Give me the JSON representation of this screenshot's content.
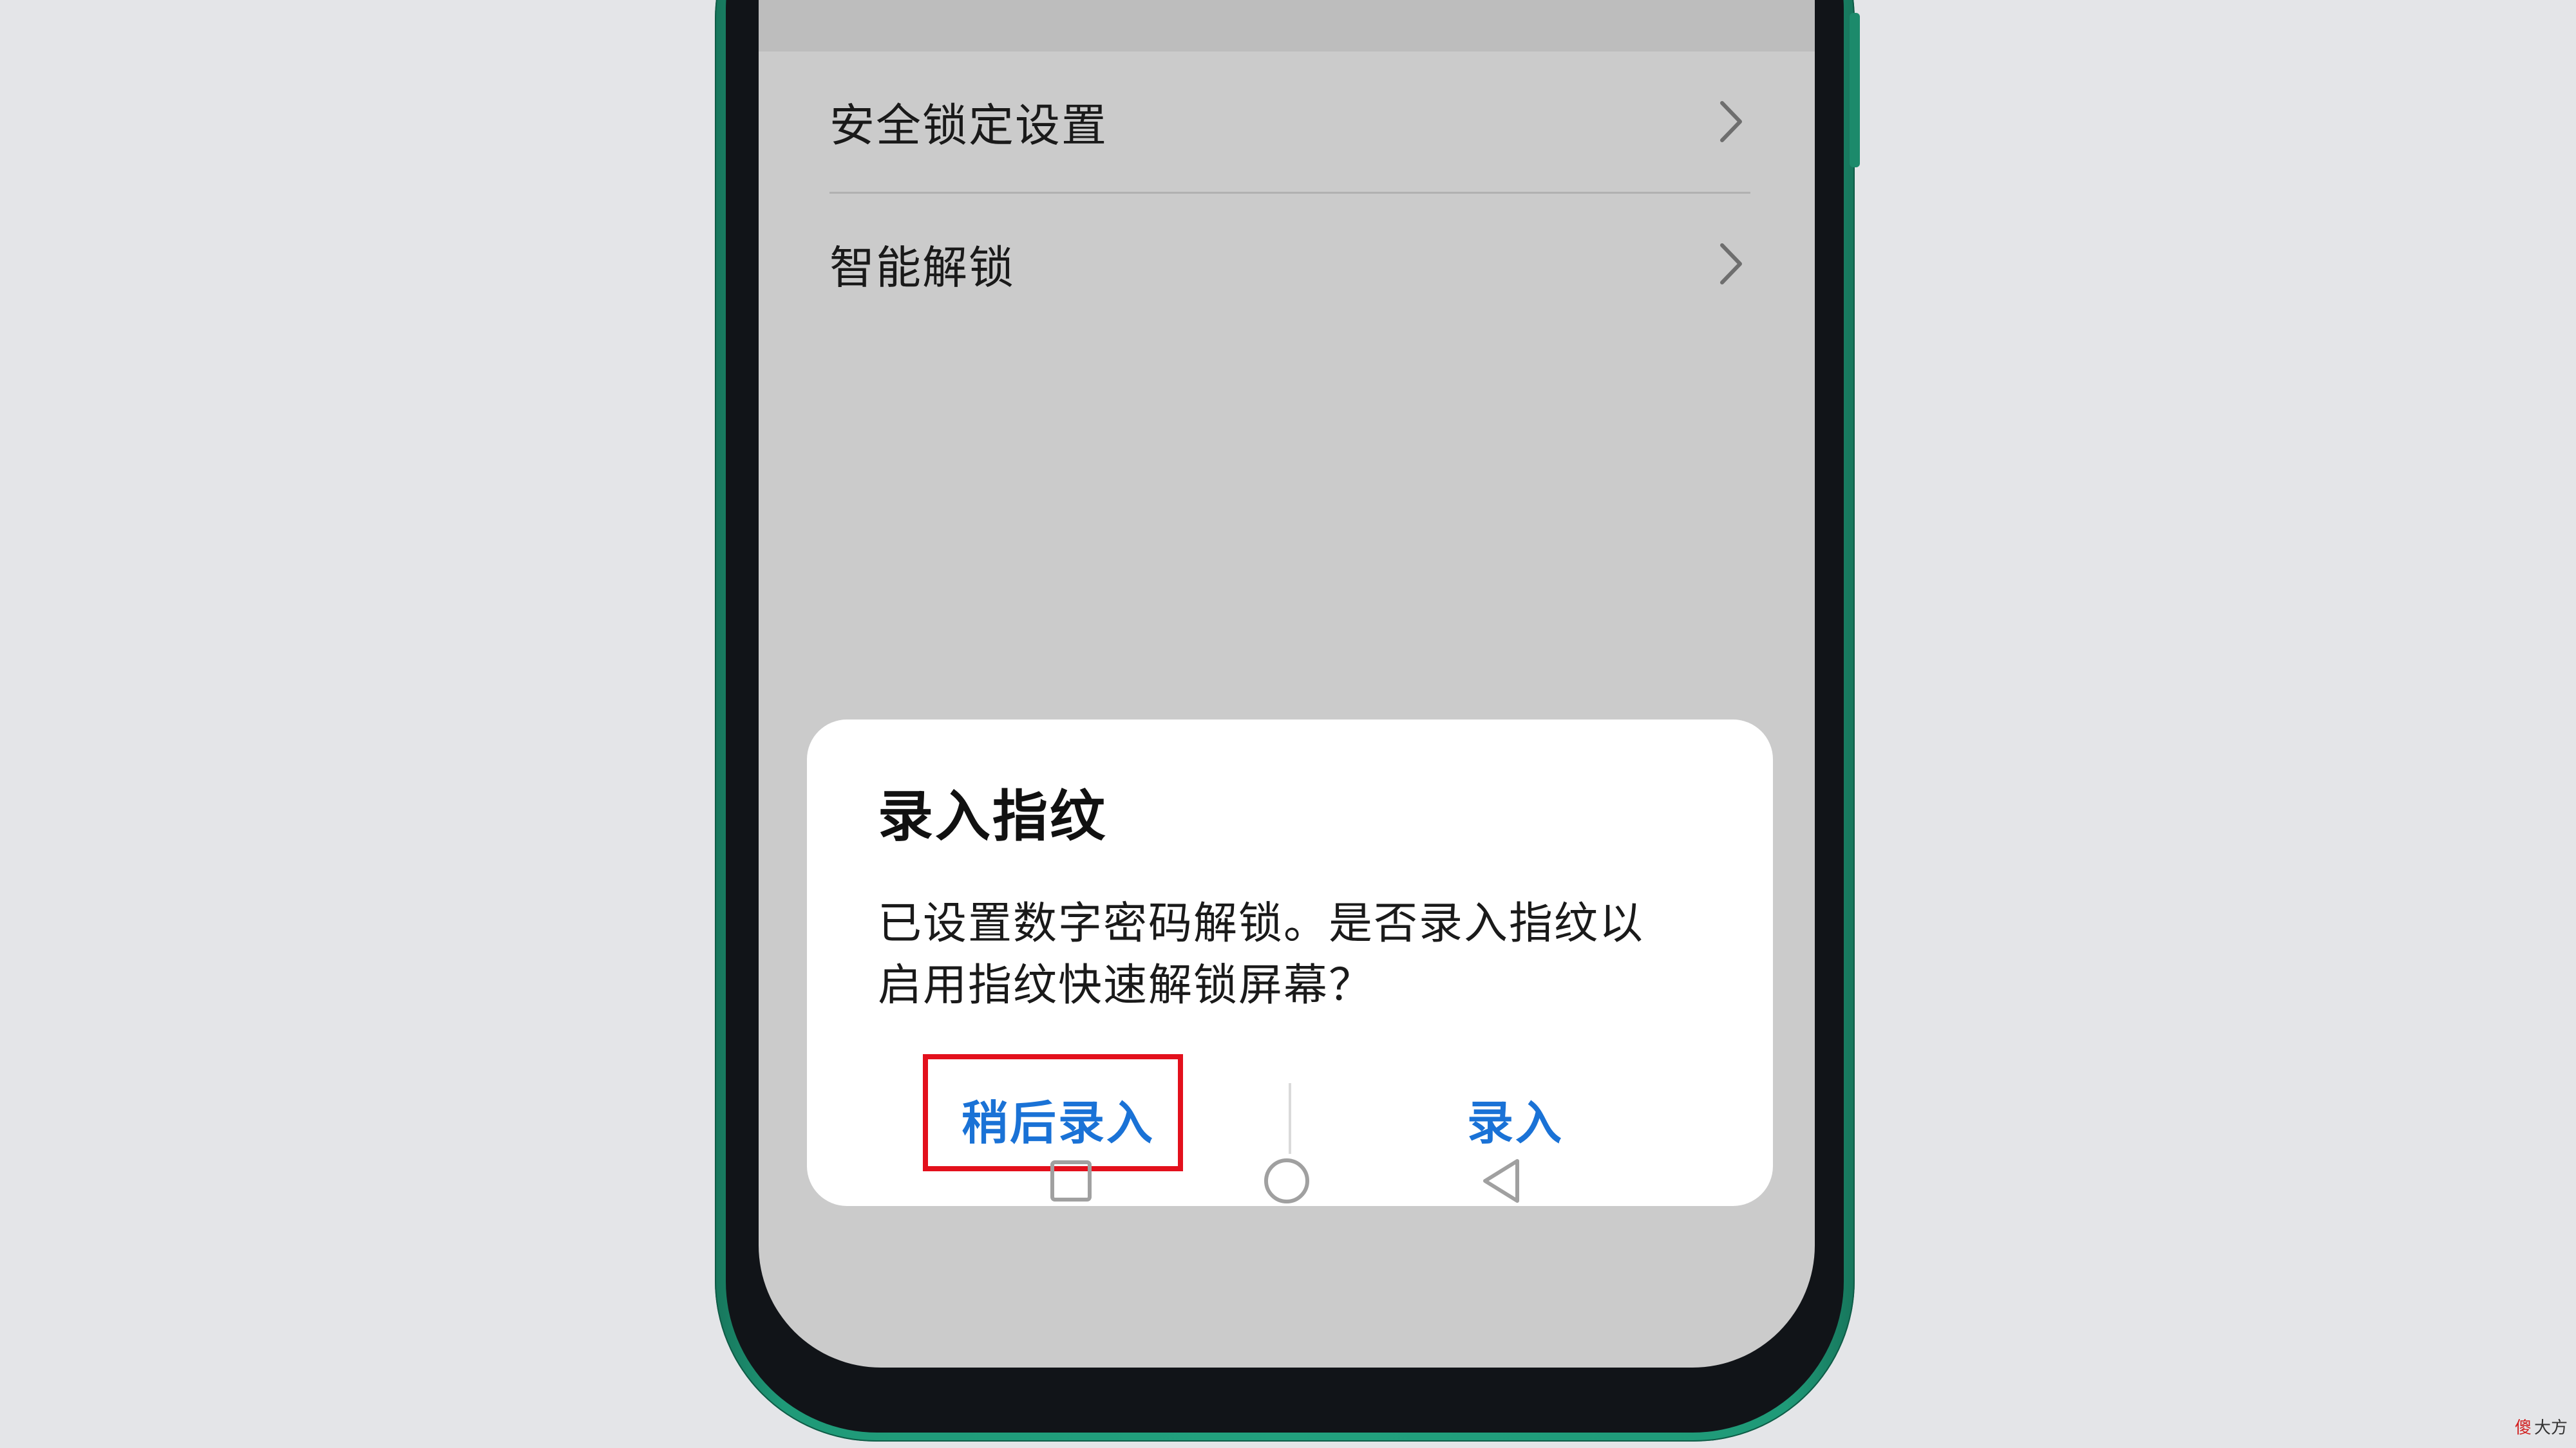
{
  "settings": {
    "items": [
      {
        "label": "安全锁定设置"
      },
      {
        "label": "智能解锁"
      }
    ]
  },
  "dialog": {
    "title": "录入指纹",
    "message_line1": "已设置数字密码解锁。是否录入指纹以",
    "message_line2": "启用指纹快速解锁屏幕？",
    "later_button": "稍后录入",
    "enroll_button": "录入"
  },
  "highlight": {
    "color": "#e3101c"
  },
  "colors": {
    "accent": "#1a72d6",
    "phone_body": "#22a17e",
    "background": "#e4e5e8"
  },
  "icons": {
    "row_chevron": "chevron-right-icon",
    "nav_recent": "square-icon",
    "nav_home": "circle-icon",
    "nav_back": "triangle-back-icon"
  },
  "watermark": {
    "logo": "傻",
    "text": "大方"
  }
}
